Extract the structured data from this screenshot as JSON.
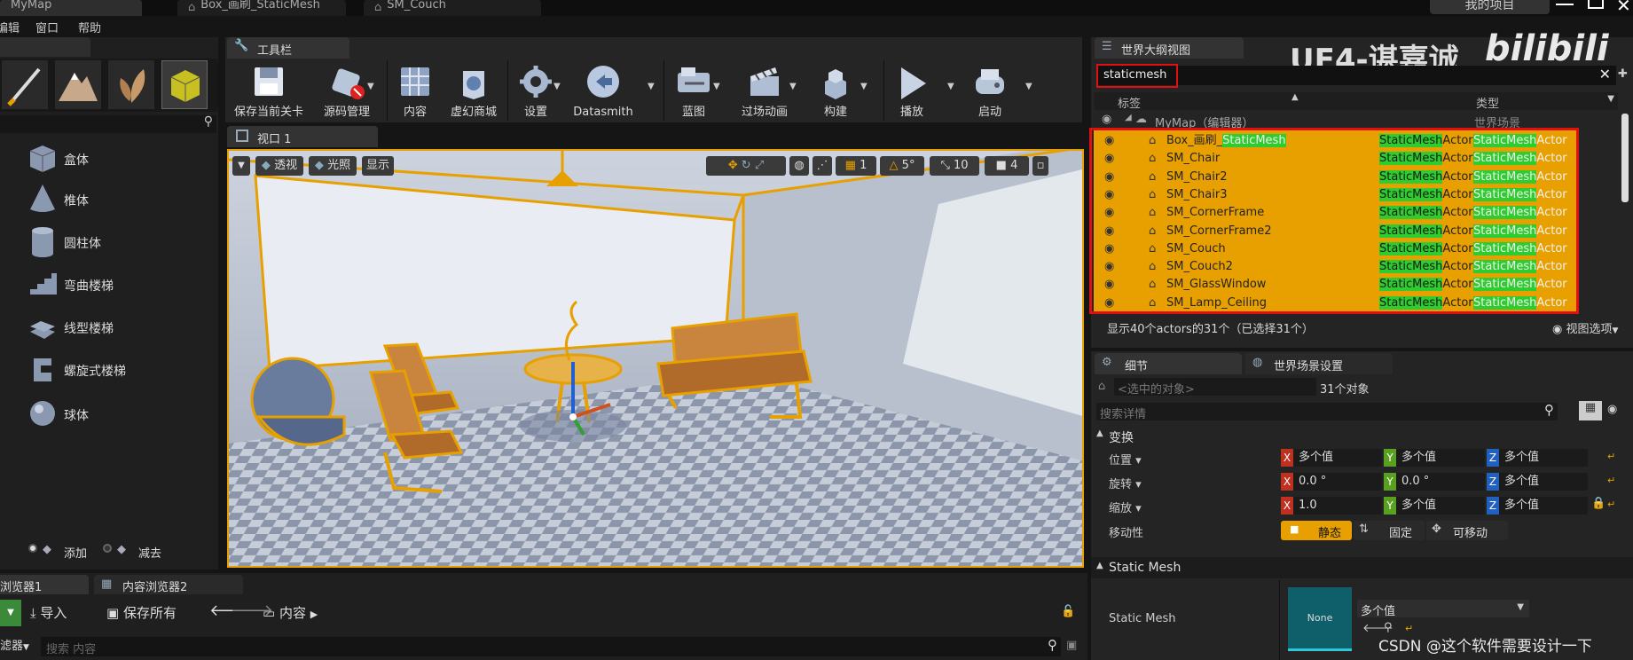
{
  "title_bar": {
    "map_tab": "MyMap",
    "tab2": "Box_画刷_StaticMesh",
    "tab3": "SM_Couch",
    "my_projects": "我的项目"
  },
  "menu": {
    "items": [
      "编辑",
      "窗口",
      "帮助"
    ]
  },
  "watermark": {
    "text": "UE4-谌嘉诚",
    "brand": "bilibili",
    "csdn": "CSDN @这个软件需要设计一下"
  },
  "place_panel": {
    "items": [
      "盒体",
      "椎体",
      "圆柱体",
      "弯曲楼梯",
      "线型楼梯",
      "螺旋式楼梯",
      "球体"
    ],
    "add_label": "添加",
    "subtract_label": "减去"
  },
  "toolbar": {
    "tab_label": "工具栏",
    "buttons": [
      "保存当前关卡",
      "源码管理",
      "内容",
      "虚幻商城",
      "设置",
      "Datasmith",
      "蓝图",
      "过场动画",
      "构建",
      "播放",
      "启动"
    ]
  },
  "viewport": {
    "tab_label": "视口 1",
    "perspective": "透视",
    "lit": "光照",
    "show": "显示",
    "grid_snap": "1",
    "rot_snap": "5°",
    "scale_snap": "10",
    "cam_speed": "4"
  },
  "content_browser": {
    "tab1": "浏览器1",
    "tab2": "内容浏览器2",
    "import": "导入",
    "save_all": "保存所有",
    "path": "内容",
    "filters": "滤器",
    "search_placeholder": "搜索 内容"
  },
  "outliner": {
    "tab_label": "世界大纲视图",
    "search_value": "staticmesh",
    "col_label": "标签",
    "col_type": "类型",
    "root_name": "MyMap（编辑器）",
    "root_type": "世界场景",
    "rows": [
      {
        "pre": "Box_画刷_",
        "hl": "StaticMesh",
        "post": ""
      },
      {
        "pre": "SM_Chair",
        "hl": "",
        "post": ""
      },
      {
        "pre": "SM_Chair2",
        "hl": "",
        "post": ""
      },
      {
        "pre": "SM_Chair3",
        "hl": "",
        "post": ""
      },
      {
        "pre": "SM_CornerFrame",
        "hl": "",
        "post": ""
      },
      {
        "pre": "SM_CornerFrame2",
        "hl": "",
        "post": ""
      },
      {
        "pre": "SM_Couch",
        "hl": "",
        "post": ""
      },
      {
        "pre": "SM_Couch2",
        "hl": "",
        "post": ""
      },
      {
        "pre": "SM_GlassWindow",
        "hl": "",
        "post": ""
      },
      {
        "pre": "SM_Lamp_Ceiling",
        "hl": "",
        "post": ""
      }
    ],
    "type_hl": "StaticMesh",
    "type_post": "Actor",
    "status": "显示40个actors的31个（已选择31个）",
    "view_options": "视图选项"
  },
  "details": {
    "tab_label": "细节",
    "tab2_label": "世界场景设置",
    "selected_placeholder": "<选中的对象>",
    "count": "31个对象",
    "search_placeholder": "搜索详情",
    "transform_section": "变换",
    "location_label": "位置",
    "rotation_label": "旋转",
    "scale_label": "缩放",
    "mobility_label": "移动性",
    "location": {
      "x": "多个值",
      "y": "多个值",
      "z": "多个值"
    },
    "rotation": {
      "x": "0.0 °",
      "y": "0.0 °",
      "z": "多个值"
    },
    "scale": {
      "x": "1.0",
      "y": "多个值",
      "z": "多个值"
    },
    "mobility": {
      "static": "静态",
      "stationary": "固定",
      "movable": "可移动"
    },
    "static_mesh_section": "Static Mesh",
    "static_mesh_label": "Static Mesh",
    "mesh_thumb": "None",
    "mesh_value": "多个值"
  },
  "colors": {
    "accent": "#e8a000",
    "highlight_green": "#2ecc2e",
    "selection_red": "#e01010"
  }
}
